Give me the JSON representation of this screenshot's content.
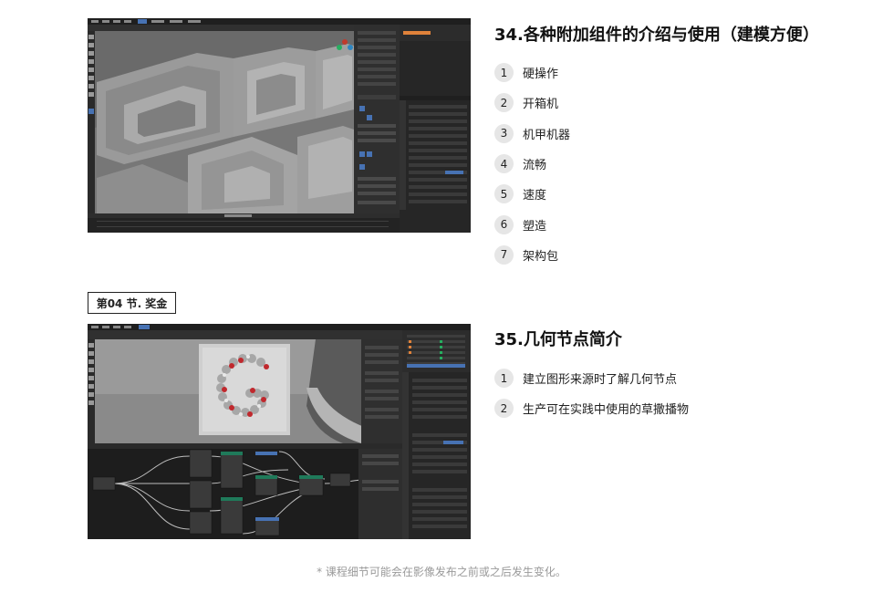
{
  "sections": [
    {
      "title": "34.各种附加组件的介绍与使用（建模方便）",
      "items": [
        {
          "num": "1",
          "label": "硬操作"
        },
        {
          "num": "2",
          "label": "开箱机"
        },
        {
          "num": "3",
          "label": "机甲机器"
        },
        {
          "num": "4",
          "label": "流畅"
        },
        {
          "num": "5",
          "label": "速度"
        },
        {
          "num": "6",
          "label": "塑造"
        },
        {
          "num": "7",
          "label": "架构包"
        }
      ]
    },
    {
      "title": "35.几何节点简介",
      "items": [
        {
          "num": "1",
          "label": "建立图形来源时了解几何节点"
        },
        {
          "num": "2",
          "label": "生产可在实践中使用的草撒播物"
        }
      ]
    }
  ],
  "section_tag": "第04 节. 奖金",
  "footnote": "* 课程细节可能会在影像发布之前或之后发生变化。",
  "colors": {
    "app_bg": "#2b2b2b",
    "viewport_gray": "#6e6e6e",
    "accent_blue": "#4772b3",
    "node_green": "#1f7a5a",
    "bead_red": "#c0282d"
  }
}
